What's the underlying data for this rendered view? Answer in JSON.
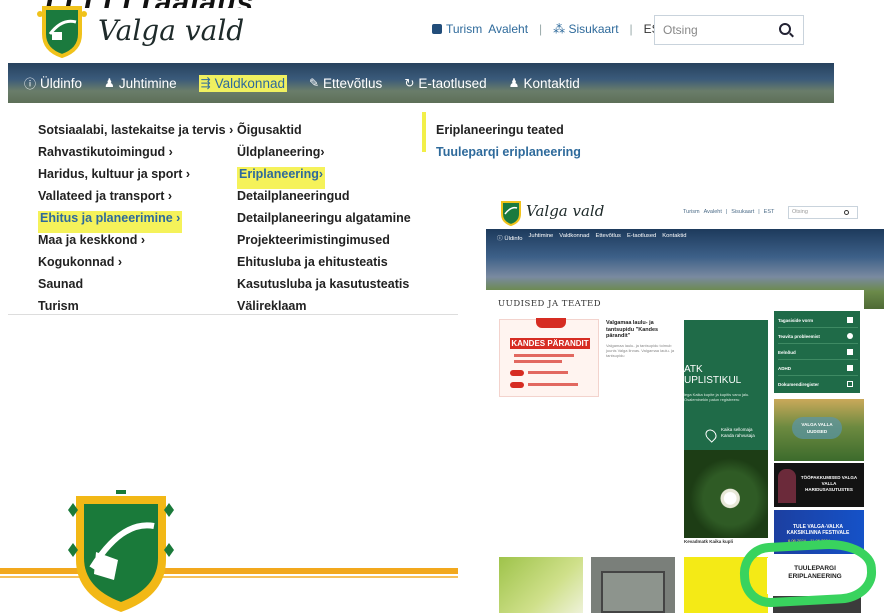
{
  "cut_title": "TTTTTTaajaus",
  "header": {
    "brand": "Valga vald",
    "top_links": [
      "Turism",
      "Avaleht",
      "Sisukaart",
      "EST"
    ],
    "search_placeholder": "Otsing"
  },
  "main_nav": [
    {
      "icon": "info-icon",
      "glyph": "ⓘ",
      "label": "Üldinfo"
    },
    {
      "icon": "people-icon",
      "glyph": "👥",
      "label": "Juhtimine"
    },
    {
      "icon": "municipality-icon",
      "glyph": "⇶",
      "label": "Valdkonnad",
      "highlighted": true
    },
    {
      "icon": "edit-icon",
      "glyph": "✎",
      "label": "Ettevõtlus"
    },
    {
      "icon": "eservice-icon",
      "glyph": "↻",
      "label": "E-taotlused"
    },
    {
      "icon": "contact-icon",
      "glyph": "👤",
      "label": "Kontaktid"
    }
  ],
  "dropdown": {
    "col1": [
      "Sotsiaalabi, lastekaitse ja tervis ›",
      "Rahvastikutoimingud ›",
      "Haridus, kultuur ja sport ›",
      "Vallateed ja transport ›",
      "Ehitus ja planeerimine ›",
      "Maa ja keskkond ›",
      "Kogukonnad ›",
      "Saunad",
      "Turism"
    ],
    "col1_highlight": 4,
    "col2": [
      "Õigusaktid",
      "Üldplaneering›",
      "Eriplaneering›",
      "Detailplaneeringud",
      "Detailplaneeringu algatamine",
      "Projekteerimistingimused",
      "Ehitusluba ja ehitusteatis",
      "Kasutusluba ja kasutusteatis",
      "Välireklaam"
    ],
    "col2_highlight": 2,
    "col3": [
      "Eriplaneeringu teated",
      "Tuuleparqi eriplaneering"
    ]
  },
  "shot2": {
    "brand": "Valga vald",
    "top_links": [
      "Turism",
      "Avaleht",
      "|",
      "Sisukaart",
      "|",
      "EST"
    ],
    "search_placeholder": "Otsing",
    "nav": [
      "ⓘ Üldinfo",
      "Juhtimine",
      "Valdkonnad",
      "Ettevõtlus",
      "E-taotlused",
      "Kontaktid"
    ],
    "news_heading": "UUDISED JA TEATED",
    "poster_title": "KANDES PÄRANDIT",
    "news_title": "Valgamaa laulu- ja tantsupidu \"Kandes pärandit\"",
    "news_text": "Valgamaa laulu- ja tantsupidu toimub juunis Valga linnas. Valgamaa laulu- ja tantsupidu",
    "green_heading": "ATK\nUPLISTIKUL",
    "green_text": "lega Kaika kupite ja kupitis vanu jalu. Osaleminekin palun registreeru",
    "green_location": "Kaika sellomaja\nKanda rahvusaja",
    "caption": "Kevadmatk Kaika kupli",
    "sidebar": [
      {
        "label": "Tagasiside vorm",
        "icon": "pencil-icon"
      },
      {
        "label": "Teavita probleemist",
        "icon": "chat-icon"
      },
      {
        "label": "Eelnõud",
        "icon": "document-icon"
      },
      {
        "label": "ADHD",
        "icon": "document-icon"
      },
      {
        "label": "Dokumendiregister",
        "icon": "mail-icon"
      }
    ],
    "tiles": {
      "t1": "VALGA VALLA UUDISED",
      "t2": "TÖÖPAKKUMISED VALGA VALLA HARIDUSASUTUSTES",
      "t3": "TULE VALGA-VALKA KAKSIKLINNA FESTIVALE",
      "t3_dates": "6.06.2024 – 11.06.2024",
      "t4": "TUULEPARGI ERIPLANEERING"
    }
  },
  "colors": {
    "highlight": "#f5f25a",
    "link_blue": "#2e6a9b",
    "valga_green": "#1f6b48",
    "annotation_ring": "#39d35e",
    "orange": "#f2a81d"
  }
}
